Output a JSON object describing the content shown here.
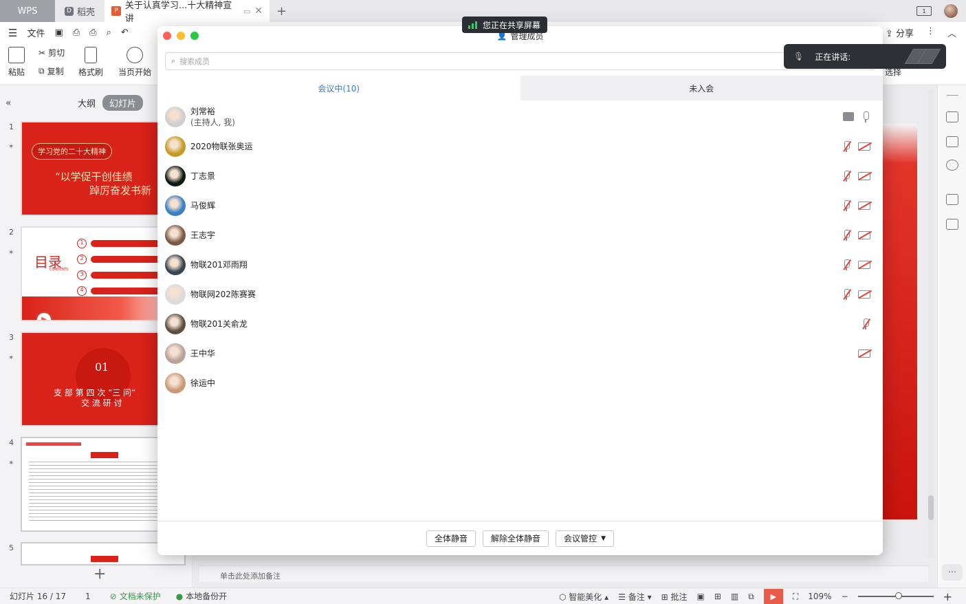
{
  "tabs": {
    "wps": "WPS",
    "daoke": "稻壳",
    "doc_title": "关于认真学习...十大精神宣讲"
  },
  "menu": {
    "file": "文件",
    "share": "分享"
  },
  "ribbon": {
    "paste": "粘贴",
    "cut": "剪切",
    "copy": "复制",
    "format_painter": "格式刷",
    "from_current": "当页开始",
    "select": "选择"
  },
  "left_panel": {
    "outline_tab": "大纲",
    "slides_tab": "幻灯片"
  },
  "slides": [
    {
      "num": "1",
      "title": "学习党的二十大精神",
      "line1": "“以学促干创佳绩",
      "line2": "踔厉奋发书新"
    },
    {
      "num": "2",
      "title": "目录",
      "sub": "CONTENTS",
      "items": [
        "1",
        "2",
        "3",
        "4"
      ]
    },
    {
      "num": "3",
      "big": "01",
      "line1": "支 部 第 四 次 “三 问”",
      "line2": "交 流 研 讨"
    },
    {
      "num": "4"
    },
    {
      "num": "5"
    }
  ],
  "notes_placeholder": "单击此处添加备注",
  "status": {
    "slide_count": "幻灯片 16 / 17",
    "page": "1",
    "doc_protect": "文档未保护",
    "backup": "本地备份开",
    "beautify": "智能美化",
    "notes": "备注",
    "comment": "批注",
    "zoom": "109%"
  },
  "share_banner": "您正在共享屏幕",
  "speaking": {
    "label": "正在讲话:"
  },
  "dialog": {
    "title": "管理成员",
    "search_placeholder": "搜索成员",
    "tab_in": "会议中(10)",
    "tab_out": "未入会",
    "members": [
      {
        "name": "刘常裕",
        "role": "(主持人, 我)",
        "mic": "on",
        "cam": "screen",
        "color": "#cfcfcf"
      },
      {
        "name": "2020物联张奥运",
        "mic": "off",
        "cam": "off",
        "color": "#c79a26"
      },
      {
        "name": "丁志景",
        "mic": "off",
        "cam": "off",
        "color": "#0d1a12"
      },
      {
        "name": "马俊辉",
        "mic": "off",
        "cam": "off",
        "color": "#3b7fc4"
      },
      {
        "name": "王志宇",
        "mic": "off",
        "cam": "off",
        "color": "#7a5a46"
      },
      {
        "name": "物联201邓雨翔",
        "mic": "off",
        "cam": "off",
        "color": "#3a4552"
      },
      {
        "name": "物联网202陈赛赛",
        "mic": "off",
        "cam": "off",
        "color": "#dcdcdc"
      },
      {
        "name": "物联201关俞龙",
        "mic": "off",
        "cam": "none",
        "color": "#5e5040"
      },
      {
        "name": "王中华",
        "mic": "none",
        "cam": "off",
        "color": "#b9a19a"
      },
      {
        "name": "徐运中",
        "mic": "none",
        "cam": "none",
        "color": "#c99a77"
      }
    ],
    "btn_mute_all": "全体静音",
    "btn_unmute_all": "解除全体静音",
    "btn_control": "会议管控"
  }
}
